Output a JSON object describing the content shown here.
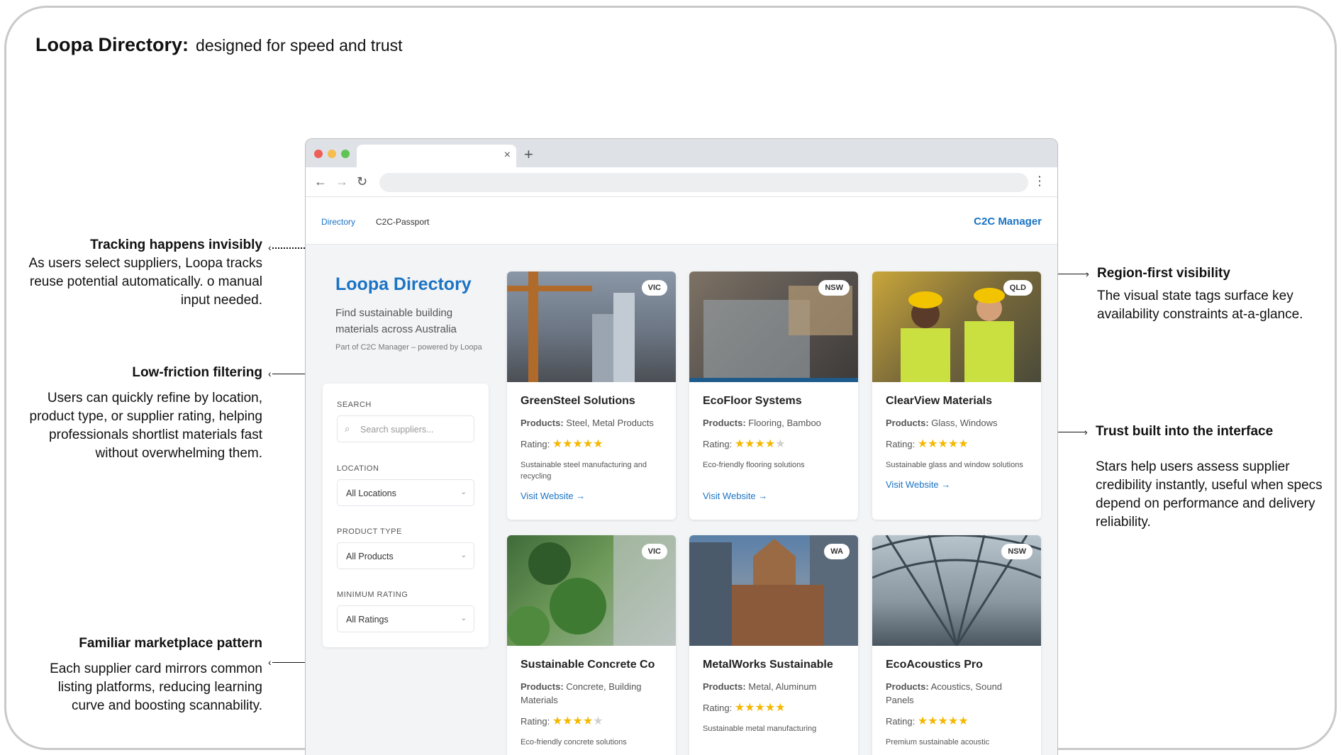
{
  "page": {
    "title_bold": "Loopa Directory:",
    "title_rest": "designed for speed and trust"
  },
  "annotations": {
    "tracking": {
      "heading": "Tracking happens invisibly",
      "body": "As users select suppliers, Loopa tracks reuse potential automatically. o manual input needed."
    },
    "filtering": {
      "heading": "Low-friction filtering",
      "body": "Users can quickly refine by location, product type, or supplier rating, helping professionals shortlist materials fast without overwhelming them."
    },
    "marketplace": {
      "heading": "Familiar marketplace pattern",
      "body": "Each supplier card mirrors common listing platforms, reducing learning curve and boosting scannability."
    },
    "region": {
      "heading": "Region-first visibility",
      "body": "The visual state tags surface key availability constraints at-a-glance."
    },
    "trust": {
      "heading": "Trust built into the interface",
      "body": "Stars help users assess supplier credibility instantly, useful when specs depend on performance and delivery reliability."
    }
  },
  "browser": {
    "tab_close": "×",
    "tab_plus": "+",
    "back": "←",
    "forward": "→",
    "reload": "↻",
    "menu": "⋮"
  },
  "app_nav": {
    "links": [
      "Directory",
      "C2C-Passport"
    ],
    "brand": "C2C Manager",
    "accent": "#1a73c4"
  },
  "sidebar": {
    "title": "Loopa Directory",
    "description": "Find sustainable building materials across Australia",
    "powered": "Part of C2C Manager – powered by Loopa"
  },
  "filters": {
    "search_label": "SEARCH",
    "search_placeholder": "Search suppliers...",
    "location_label": "LOCATION",
    "location_value": "All Locations",
    "product_label": "PRODUCT TYPE",
    "product_value": "All Products",
    "rating_label": "MINIMUM RATING",
    "rating_value": "All Ratings"
  },
  "cards": [
    {
      "name": "GreenSteel Solutions",
      "region": "VIC",
      "products_label": "Products:",
      "products": "Steel, Metal Products",
      "rating_label": "Rating:",
      "rating": 5,
      "description": "Sustainable steel manufacturing and recycling",
      "visit": "Visit Website →"
    },
    {
      "name": "EcoFloor Systems",
      "region": "NSW",
      "products_label": "Products:",
      "products": "Flooring, Bamboo",
      "rating_label": "Rating:",
      "rating": 4,
      "description": "Eco-friendly flooring solutions",
      "visit": "Visit Website →"
    },
    {
      "name": "ClearView Materials",
      "region": "QLD",
      "products_label": "Products:",
      "products": "Glass, Windows",
      "rating_label": "Rating:",
      "rating": 5,
      "description": "Sustainable glass and window solutions",
      "visit": "Visit Website →"
    },
    {
      "name": "Sustainable Concrete Co",
      "region": "VIC",
      "products_label": "Products:",
      "products": "Concrete, Building Materials",
      "rating_label": "Rating:",
      "rating": 4,
      "description": "Eco-friendly concrete solutions",
      "visit": ""
    },
    {
      "name": "MetalWorks Sustainable",
      "region": "WA",
      "products_label": "Products:",
      "products": "Metal, Aluminum",
      "rating_label": "Rating:",
      "rating": 5,
      "description": "Sustainable metal manufacturing",
      "visit": ""
    },
    {
      "name": "EcoAcoustics Pro",
      "region": "NSW",
      "products_label": "Products:",
      "products": "Acoustics, Sound Panels",
      "rating_label": "Rating:",
      "rating": 5,
      "description": "Premium sustainable acoustic",
      "visit": ""
    }
  ]
}
